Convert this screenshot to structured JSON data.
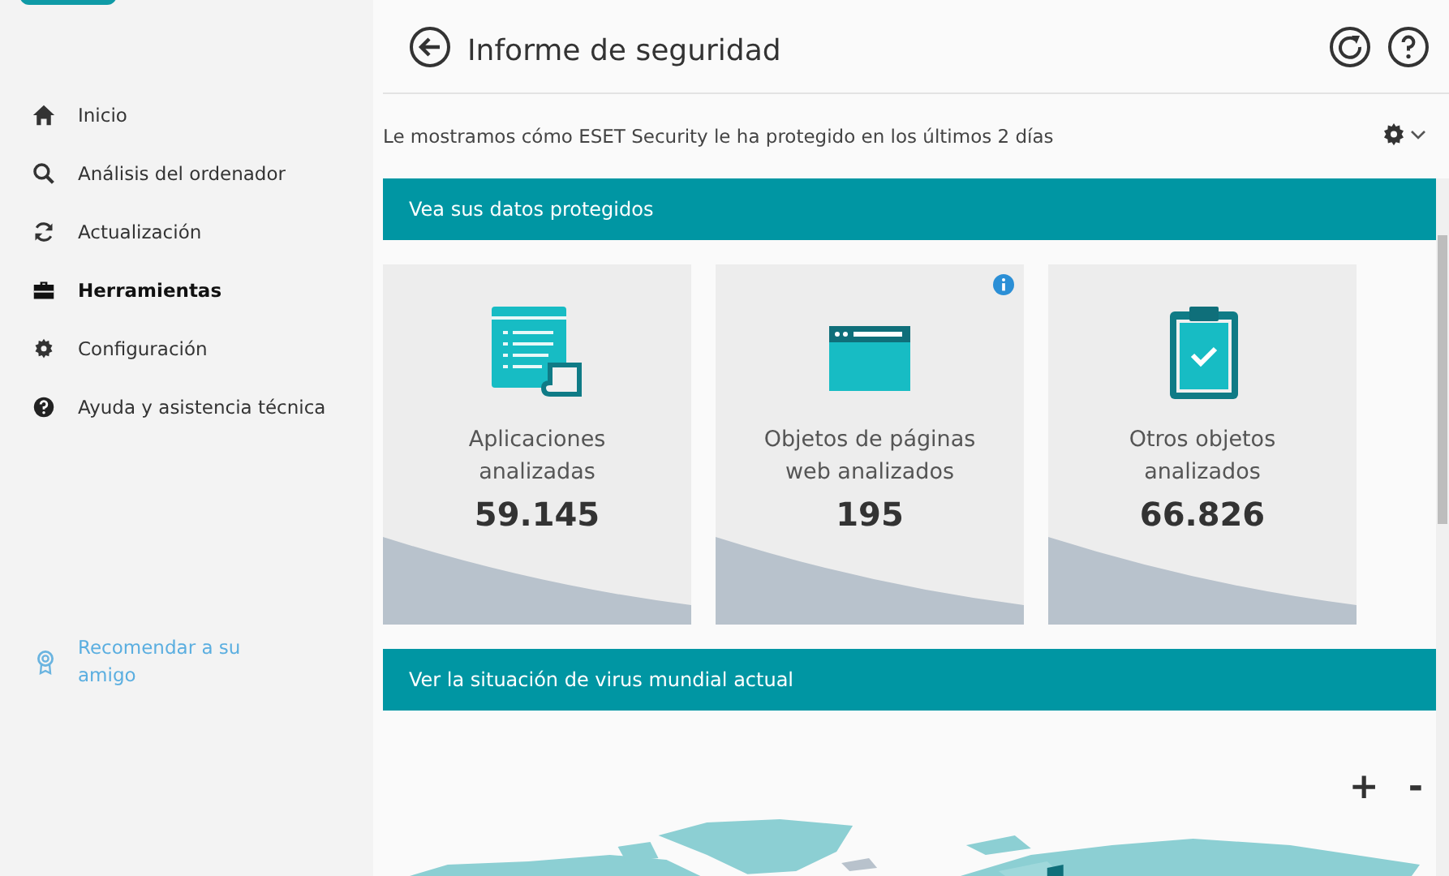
{
  "sidebar": {
    "items": [
      {
        "label": "Inicio",
        "kind": "home",
        "selected": false
      },
      {
        "label": "Análisis del ordenador",
        "kind": "search",
        "selected": false
      },
      {
        "label": "Actualización",
        "kind": "refresh",
        "selected": false
      },
      {
        "label": "Herramientas",
        "kind": "briefcase",
        "selected": true
      },
      {
        "label": "Configuración",
        "kind": "gear",
        "selected": false
      },
      {
        "label": "Ayuda y asistencia técnica",
        "kind": "help",
        "selected": false
      }
    ],
    "recommend": {
      "label": "Recomendar a su amigo"
    }
  },
  "header": {
    "title": "Informe de seguridad"
  },
  "subtitle": "Le mostramos cómo ESET Security le ha protegido en los últimos 2 días",
  "sections": [
    {
      "title": "Vea sus datos protegidos"
    },
    {
      "title": "Ver la situación de virus mundial actual"
    }
  ],
  "cards": [
    {
      "kind": "apps",
      "label": "Aplicaciones analizadas",
      "value": "59.145",
      "info": false
    },
    {
      "kind": "browser",
      "label": "Objetos de páginas web analizados",
      "value": "195",
      "info": true
    },
    {
      "kind": "clipboard",
      "label": "Otros objetos analizados",
      "value": "66.826",
      "info": false
    }
  ],
  "map": {
    "zoom_in": "+",
    "zoom_out": "-"
  }
}
